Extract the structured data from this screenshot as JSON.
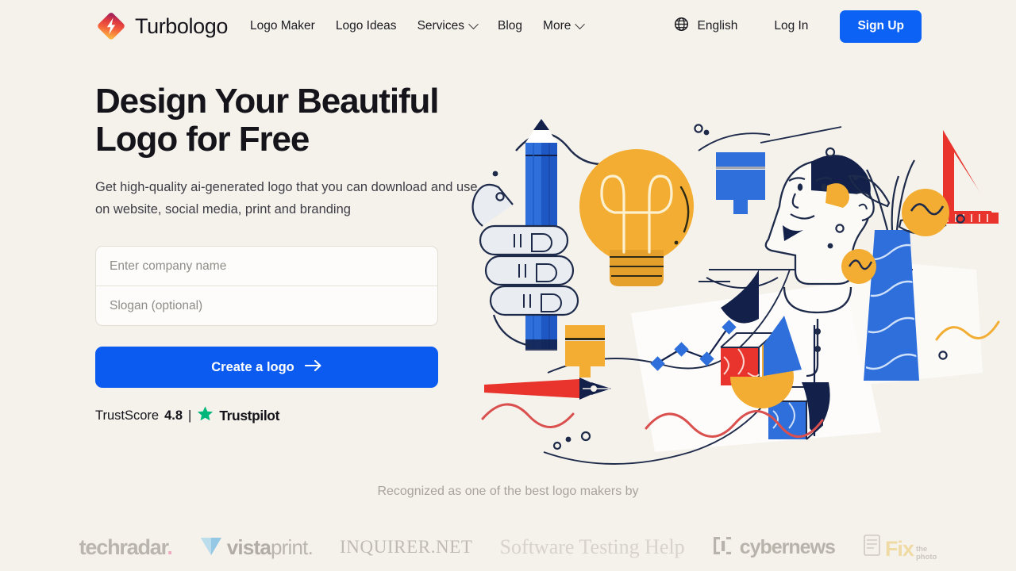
{
  "brand": {
    "name": "Turbologo",
    "logo_icon": "turbologo-diamond-bolt-icon"
  },
  "nav": {
    "items": [
      {
        "label": "Logo Maker",
        "has_dropdown": false
      },
      {
        "label": "Logo Ideas",
        "has_dropdown": false
      },
      {
        "label": "Services",
        "has_dropdown": true
      },
      {
        "label": "Blog",
        "has_dropdown": false
      },
      {
        "label": "More",
        "has_dropdown": true
      }
    ]
  },
  "header_right": {
    "globe_icon": "globe-icon",
    "language": "English",
    "login_label": "Log In",
    "signup_label": "Sign Up",
    "signup_color": "#0b62f5"
  },
  "hero": {
    "headline": "Design Your Beautiful Logo for Free",
    "subhead": "Get high-quality ai-generated logo that you can download and use on website, social media, print and branding",
    "company_placeholder": "Enter company name",
    "company_value": "",
    "slogan_placeholder": "Slogan (optional)",
    "slogan_value": "",
    "cta_label": "Create a logo",
    "cta_arrow_icon": "arrow-right-icon",
    "cta_color": "#0b5bf0"
  },
  "trustpilot": {
    "label": "TrustScore",
    "score": "4.8",
    "separator": "|",
    "star_icon": "star-icon",
    "star_color": "#00b67a",
    "brand": "Trustpilot"
  },
  "awards": {
    "caption": "Recognized as one of the best logo makers by",
    "logos": [
      {
        "name": "techradar",
        "text": "techradar",
        "suffix": "."
      },
      {
        "name": "vistaprint",
        "text_bold": "vista",
        "text_light": "print",
        "suffix": "."
      },
      {
        "name": "inquirer-net",
        "text": "INQUIRER.NET"
      },
      {
        "name": "software-testing-help",
        "text": "Software Testing Help"
      },
      {
        "name": "cybernews",
        "text": "cybernews"
      },
      {
        "name": "fixthephoto",
        "text": "Fix",
        "sub_top": "the",
        "sub_bottom": "photo"
      }
    ]
  },
  "illustration": {
    "name": "design-tools-hero-illustration",
    "elements": [
      "hand-holding-pencil",
      "lightbulb",
      "man-head-profile",
      "triangle-ruler",
      "blue-paint-swatch",
      "red-cube",
      "blue-cube",
      "pen-nib",
      "line-chart",
      "pie-chart",
      "blue-vase-with-plant",
      "yellow-flowers",
      "wavy-lines"
    ],
    "colors": {
      "yellow": "#f2ad32",
      "blue": "#2f6fdb",
      "navy": "#12204a",
      "red": "#e8342c",
      "pink_red": "#d9504f"
    }
  }
}
